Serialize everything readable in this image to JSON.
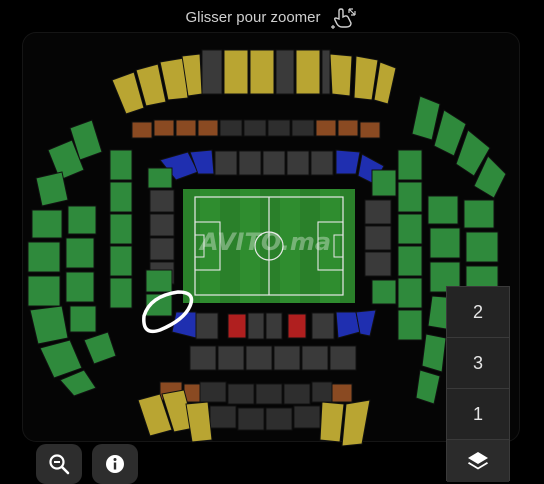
{
  "hint": {
    "text": "Glisser pour zoomer",
    "icon": "pinch-zoom-icon"
  },
  "levels": [
    {
      "label": "2"
    },
    {
      "label": "3"
    },
    {
      "label": "1"
    }
  ],
  "controls": {
    "layers_icon": "layers-icon",
    "zoom_icon": "zoom-out-icon",
    "info_icon": "info-icon"
  },
  "watermark": "AVITO.ma",
  "colors": {
    "background": "#000000",
    "green_sections": "#2f8a3c",
    "yellow_sections": "#b9a532",
    "blue_sections": "#1f2fb0",
    "red_sections": "#b01f1f",
    "orange_sections": "#8a4a22",
    "grey_sections": "#3a3a3a",
    "pitch": "#2f8d2f",
    "selection_circle": "#ffffff"
  }
}
